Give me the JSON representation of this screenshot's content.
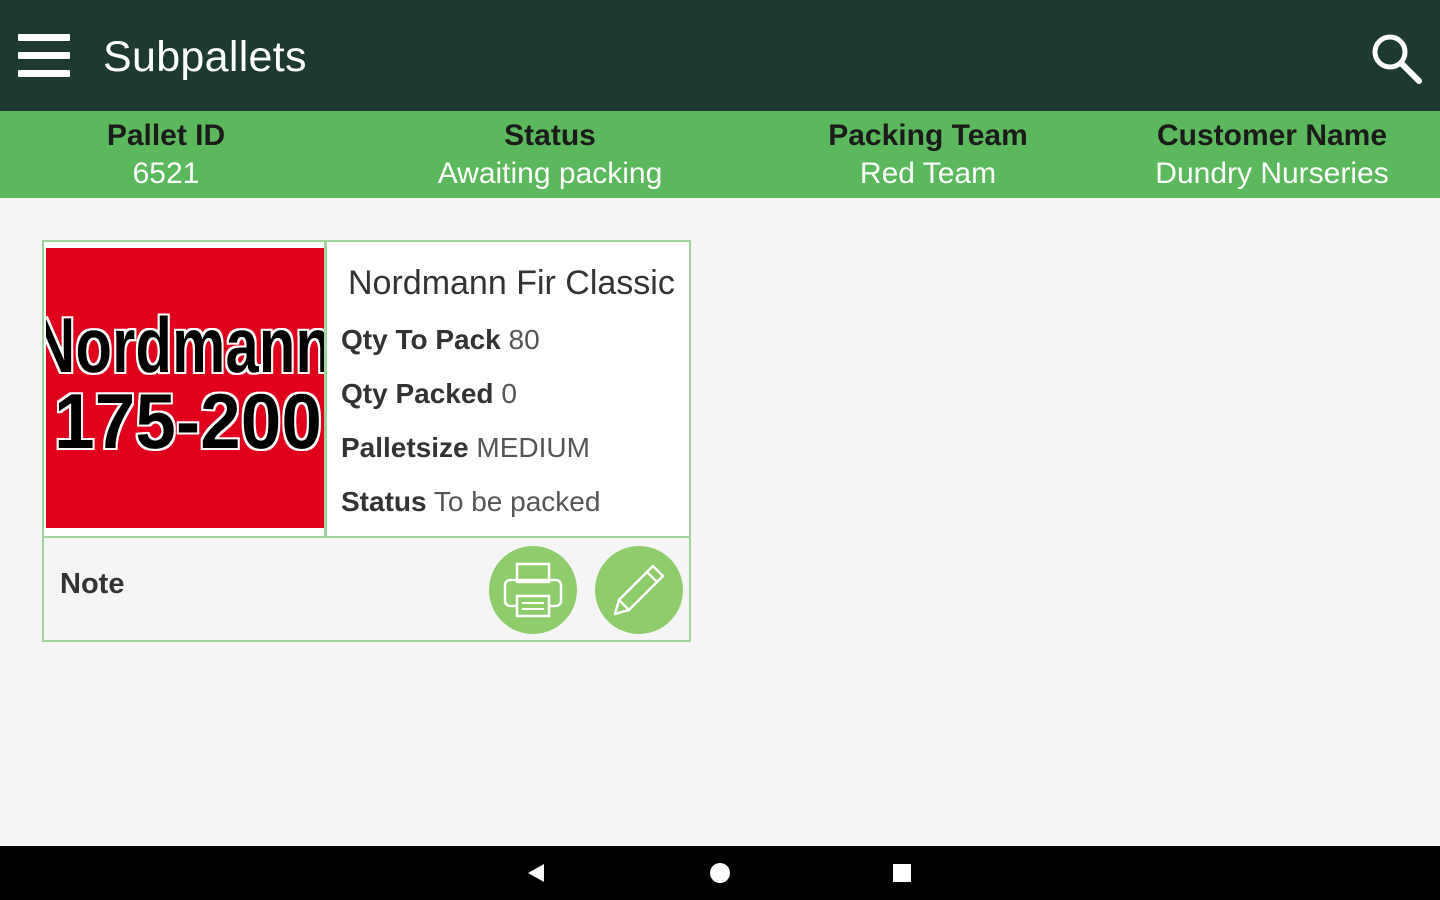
{
  "app_bar": {
    "title": "Subpallets",
    "background_color": "#1e3832",
    "menu_icon": "hamburger-menu-icon",
    "search_icon": "search-icon"
  },
  "info_bar": {
    "background_color": "#5cb85c",
    "pallet_id": {
      "label": "Pallet ID",
      "value": "6521"
    },
    "status": {
      "label": "Status",
      "value": "Awaiting packing"
    },
    "packing_team": {
      "label": "Packing Team",
      "value": "Red Team"
    },
    "customer_name": {
      "label": "Customer Name",
      "value": "Dundry Nurseries"
    }
  },
  "subpallet_card": {
    "thumbnail": {
      "line1": "Nordmann",
      "line2": "175-200",
      "background_color": "#e0001b"
    },
    "product_name": "Nordmann Fir Classic",
    "qty_to_pack": {
      "label": "Qty To Pack",
      "value": "80"
    },
    "qty_packed": {
      "label": "Qty Packed",
      "value": "0"
    },
    "palletsize": {
      "label": "Palletsize",
      "value": "MEDIUM"
    },
    "status": {
      "label": "Status",
      "value": "To be packed"
    },
    "note_label": "Note",
    "print_button_icon": "printer-icon",
    "edit_button_icon": "pencil-icon",
    "button_color": "#8fcc6b"
  },
  "system_nav": {
    "back_icon": "back-triangle-icon",
    "home_icon": "home-circle-icon",
    "recents_icon": "recents-square-icon"
  }
}
